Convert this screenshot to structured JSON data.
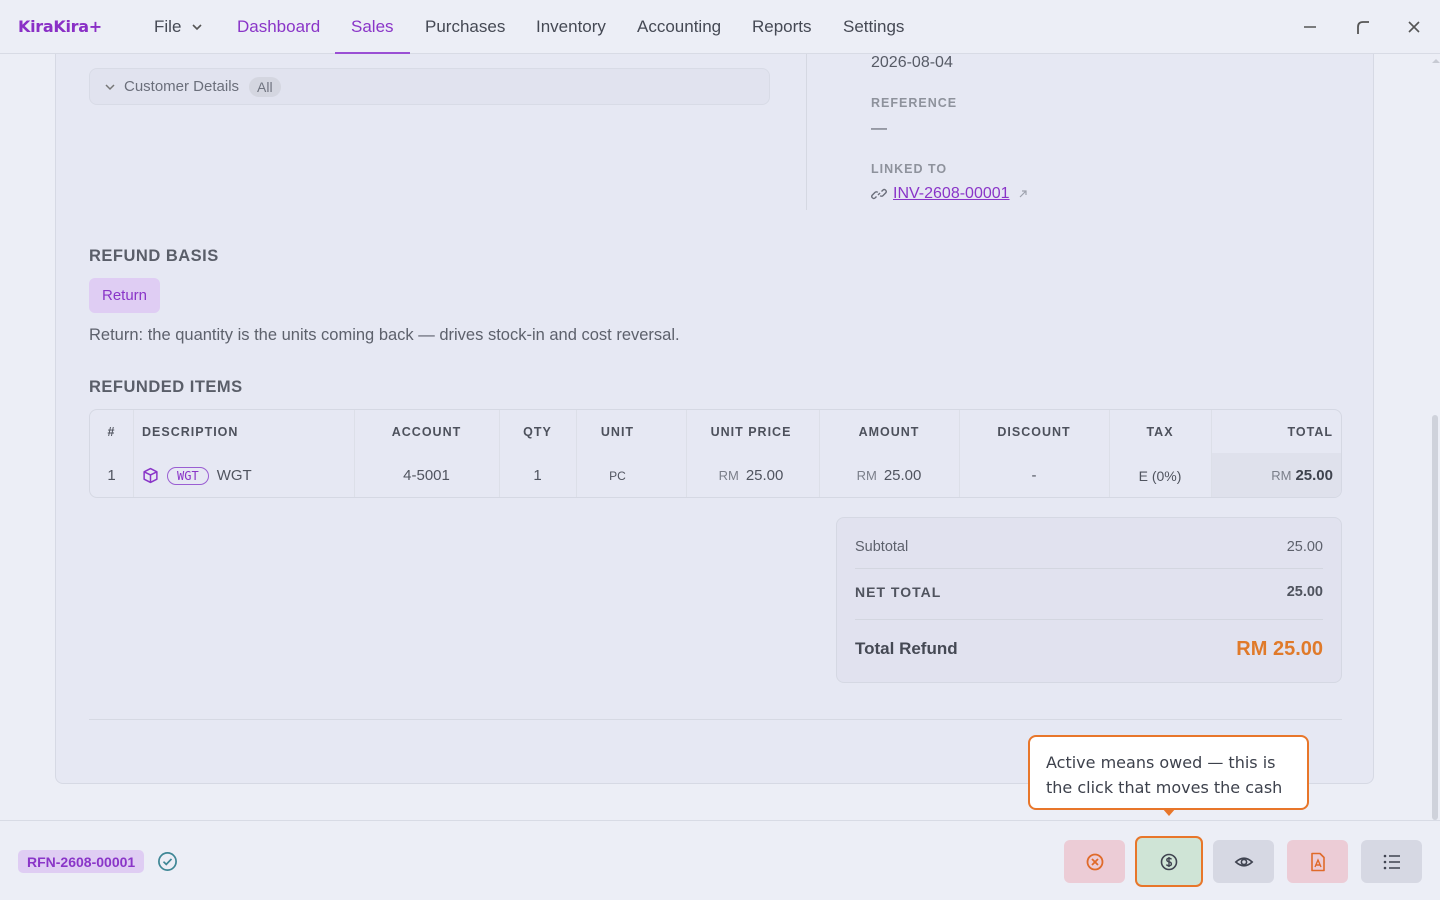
{
  "app": {
    "logo": "KiraKira+"
  },
  "menu": {
    "file": "File",
    "items": [
      {
        "label": "Dashboard"
      },
      {
        "label": "Sales"
      },
      {
        "label": "Purchases"
      },
      {
        "label": "Inventory"
      },
      {
        "label": "Accounting"
      },
      {
        "label": "Reports"
      },
      {
        "label": "Settings"
      }
    ],
    "active": "Sales"
  },
  "customer_details": {
    "label": "Customer Details",
    "filter": "All"
  },
  "meta": {
    "date": "2026-08-04",
    "reference_label": "REFERENCE",
    "reference_value": "—",
    "linked_label": "LINKED TO",
    "linked_value": "INV-2608-00001"
  },
  "refund_basis": {
    "title": "REFUND BASIS",
    "button": "Return",
    "description": "Return: the quantity is the units coming back — drives stock-in and cost reversal."
  },
  "items": {
    "title": "REFUNDED ITEMS",
    "headers": {
      "num": "#",
      "description": "DESCRIPTION",
      "account": "ACCOUNT",
      "qty": "QTY",
      "unit": "UNIT",
      "unit_price": "UNIT PRICE",
      "amount": "AMOUNT",
      "discount": "DISCOUNT",
      "tax": "TAX",
      "total": "TOTAL"
    },
    "rows": [
      {
        "num": "1",
        "tag": "WGT",
        "description": "WGT",
        "account": "4-5001",
        "qty": "1",
        "unit": "PC",
        "currency": "RM",
        "unit_price": "25.00",
        "amount": "25.00",
        "discount": "-",
        "tax": "E (0%)",
        "total": "25.00"
      }
    ]
  },
  "summary": {
    "subtotal_label": "Subtotal",
    "subtotal_value": "25.00",
    "net_label": "NET TOTAL",
    "net_value": "25.00",
    "refund_label": "Total Refund",
    "refund_value": "RM 25.00"
  },
  "tooltip": {
    "text": "Active means owed — this is the click that moves the cash"
  },
  "footer": {
    "doc_number": "RFN-2608-00001"
  },
  "colors": {
    "accent": "#8a35c8",
    "highlight": "#e8762a",
    "refund_total": "#e07a2a"
  }
}
